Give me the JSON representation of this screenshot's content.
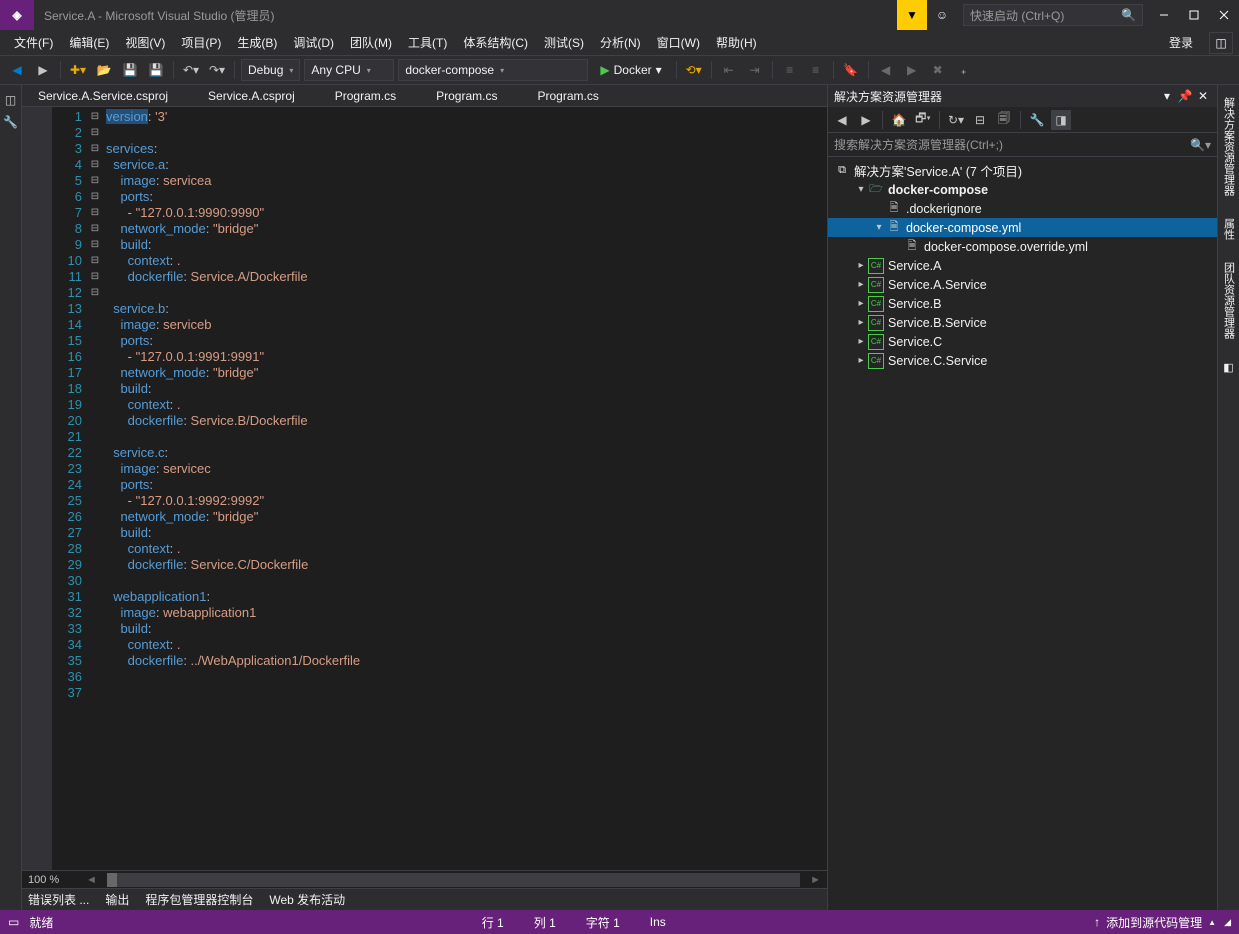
{
  "titlebar": {
    "title": "Service.A - Microsoft Visual Studio  (管理员)",
    "quick_launch_placeholder": "快速启动 (Ctrl+Q)"
  },
  "menubar": {
    "items": [
      "文件(F)",
      "编辑(E)",
      "视图(V)",
      "项目(P)",
      "生成(B)",
      "调试(D)",
      "团队(M)",
      "工具(T)",
      "体系结构(C)",
      "测试(S)",
      "分析(N)",
      "窗口(W)",
      "帮助(H)"
    ],
    "login": "登录"
  },
  "toolbar": {
    "config": "Debug",
    "platform": "Any CPU",
    "startup": "docker-compose",
    "run": "Docker"
  },
  "doctabs": [
    "Service.A.Service.csproj",
    "Service.A.csproj",
    "Program.cs",
    "Program.cs",
    "Program.cs"
  ],
  "editor": {
    "zoom": "100 %",
    "lines": [
      {
        "n": 1,
        "seg": [
          {
            "c": "k",
            "t": "version",
            "sel": true
          },
          {
            "c": "p",
            "t": ": "
          },
          {
            "c": "s",
            "t": "'3'"
          }
        ]
      },
      {
        "n": 2,
        "seg": []
      },
      {
        "n": 3,
        "fold": "-",
        "seg": [
          {
            "c": "k",
            "t": "services"
          },
          {
            "c": "p",
            "t": ":"
          }
        ]
      },
      {
        "n": 4,
        "fold": "-",
        "seg": [
          {
            "c": "p",
            "t": "  "
          },
          {
            "c": "k",
            "t": "service.a"
          },
          {
            "c": "p",
            "t": ":"
          }
        ]
      },
      {
        "n": 5,
        "seg": [
          {
            "c": "p",
            "t": "    "
          },
          {
            "c": "k",
            "t": "image"
          },
          {
            "c": "p",
            "t": ": "
          },
          {
            "c": "s",
            "t": "servicea"
          }
        ]
      },
      {
        "n": 6,
        "fold": "-",
        "seg": [
          {
            "c": "p",
            "t": "    "
          },
          {
            "c": "k",
            "t": "ports"
          },
          {
            "c": "p",
            "t": ":"
          }
        ]
      },
      {
        "n": 7,
        "seg": [
          {
            "c": "p",
            "t": "      - "
          },
          {
            "c": "s",
            "t": "\"127.0.0.1:9990:9990\""
          }
        ]
      },
      {
        "n": 8,
        "seg": [
          {
            "c": "p",
            "t": "    "
          },
          {
            "c": "k",
            "t": "network_mode"
          },
          {
            "c": "p",
            "t": ": "
          },
          {
            "c": "s",
            "t": "\"bridge\""
          }
        ]
      },
      {
        "n": 9,
        "fold": "-",
        "seg": [
          {
            "c": "p",
            "t": "    "
          },
          {
            "c": "k",
            "t": "build"
          },
          {
            "c": "p",
            "t": ":"
          }
        ]
      },
      {
        "n": 10,
        "seg": [
          {
            "c": "p",
            "t": "      "
          },
          {
            "c": "k",
            "t": "context"
          },
          {
            "c": "p",
            "t": ": "
          },
          {
            "c": "s",
            "t": "."
          }
        ]
      },
      {
        "n": 11,
        "seg": [
          {
            "c": "p",
            "t": "      "
          },
          {
            "c": "k",
            "t": "dockerfile"
          },
          {
            "c": "p",
            "t": ": "
          },
          {
            "c": "s",
            "t": "Service.A/Dockerfile"
          }
        ]
      },
      {
        "n": 12,
        "seg": []
      },
      {
        "n": 13,
        "fold": "-",
        "seg": [
          {
            "c": "p",
            "t": "  "
          },
          {
            "c": "k",
            "t": "service.b"
          },
          {
            "c": "p",
            "t": ":"
          }
        ]
      },
      {
        "n": 14,
        "seg": [
          {
            "c": "p",
            "t": "    "
          },
          {
            "c": "k",
            "t": "image"
          },
          {
            "c": "p",
            "t": ": "
          },
          {
            "c": "s",
            "t": "serviceb"
          }
        ]
      },
      {
        "n": 15,
        "fold": "-",
        "seg": [
          {
            "c": "p",
            "t": "    "
          },
          {
            "c": "k",
            "t": "ports"
          },
          {
            "c": "p",
            "t": ":"
          }
        ]
      },
      {
        "n": 16,
        "seg": [
          {
            "c": "p",
            "t": "      - "
          },
          {
            "c": "s",
            "t": "\"127.0.0.1:9991:9991\""
          }
        ]
      },
      {
        "n": 17,
        "seg": [
          {
            "c": "p",
            "t": "    "
          },
          {
            "c": "k",
            "t": "network_mode"
          },
          {
            "c": "p",
            "t": ": "
          },
          {
            "c": "s",
            "t": "\"bridge\""
          }
        ]
      },
      {
        "n": 18,
        "fold": "-",
        "seg": [
          {
            "c": "p",
            "t": "    "
          },
          {
            "c": "k",
            "t": "build"
          },
          {
            "c": "p",
            "t": ":"
          }
        ]
      },
      {
        "n": 19,
        "seg": [
          {
            "c": "p",
            "t": "      "
          },
          {
            "c": "k",
            "t": "context"
          },
          {
            "c": "p",
            "t": ": "
          },
          {
            "c": "s",
            "t": "."
          }
        ]
      },
      {
        "n": 20,
        "seg": [
          {
            "c": "p",
            "t": "      "
          },
          {
            "c": "k",
            "t": "dockerfile"
          },
          {
            "c": "p",
            "t": ": "
          },
          {
            "c": "s",
            "t": "Service.B/Dockerfile"
          }
        ]
      },
      {
        "n": 21,
        "seg": []
      },
      {
        "n": 22,
        "fold": "-",
        "seg": [
          {
            "c": "p",
            "t": "  "
          },
          {
            "c": "k",
            "t": "service.c"
          },
          {
            "c": "p",
            "t": ":"
          }
        ]
      },
      {
        "n": 23,
        "seg": [
          {
            "c": "p",
            "t": "    "
          },
          {
            "c": "k",
            "t": "image"
          },
          {
            "c": "p",
            "t": ": "
          },
          {
            "c": "s",
            "t": "servicec"
          }
        ]
      },
      {
        "n": 24,
        "fold": "-",
        "seg": [
          {
            "c": "p",
            "t": "    "
          },
          {
            "c": "k",
            "t": "ports"
          },
          {
            "c": "p",
            "t": ":"
          }
        ]
      },
      {
        "n": 25,
        "seg": [
          {
            "c": "p",
            "t": "      - "
          },
          {
            "c": "s",
            "t": "\"127.0.0.1:9992:9992\""
          }
        ]
      },
      {
        "n": 26,
        "seg": [
          {
            "c": "p",
            "t": "    "
          },
          {
            "c": "k",
            "t": "network_mode"
          },
          {
            "c": "p",
            "t": ": "
          },
          {
            "c": "s",
            "t": "\"bridge\""
          }
        ]
      },
      {
        "n": 27,
        "fold": "-",
        "seg": [
          {
            "c": "p",
            "t": "    "
          },
          {
            "c": "k",
            "t": "build"
          },
          {
            "c": "p",
            "t": ":"
          }
        ]
      },
      {
        "n": 28,
        "seg": [
          {
            "c": "p",
            "t": "      "
          },
          {
            "c": "k",
            "t": "context"
          },
          {
            "c": "p",
            "t": ": "
          },
          {
            "c": "s",
            "t": "."
          }
        ]
      },
      {
        "n": 29,
        "seg": [
          {
            "c": "p",
            "t": "      "
          },
          {
            "c": "k",
            "t": "dockerfile"
          },
          {
            "c": "p",
            "t": ": "
          },
          {
            "c": "s",
            "t": "Service.C/Dockerfile"
          }
        ]
      },
      {
        "n": 30,
        "seg": []
      },
      {
        "n": 31,
        "fold": "-",
        "seg": [
          {
            "c": "p",
            "t": "  "
          },
          {
            "c": "k",
            "t": "webapplication1"
          },
          {
            "c": "p",
            "t": ":"
          }
        ]
      },
      {
        "n": 32,
        "seg": [
          {
            "c": "p",
            "t": "    "
          },
          {
            "c": "k",
            "t": "image"
          },
          {
            "c": "p",
            "t": ": "
          },
          {
            "c": "s",
            "t": "webapplication1"
          }
        ]
      },
      {
        "n": 33,
        "fold": "-",
        "seg": [
          {
            "c": "p",
            "t": "    "
          },
          {
            "c": "k",
            "t": "build"
          },
          {
            "c": "p",
            "t": ":"
          }
        ]
      },
      {
        "n": 34,
        "seg": [
          {
            "c": "p",
            "t": "      "
          },
          {
            "c": "k",
            "t": "context"
          },
          {
            "c": "p",
            "t": ": "
          },
          {
            "c": "s",
            "t": "."
          }
        ]
      },
      {
        "n": 35,
        "seg": [
          {
            "c": "p",
            "t": "      "
          },
          {
            "c": "k",
            "t": "dockerfile"
          },
          {
            "c": "p",
            "t": ": "
          },
          {
            "c": "s",
            "t": "../WebApplication1/Dockerfile"
          }
        ]
      },
      {
        "n": 36,
        "seg": []
      },
      {
        "n": 37,
        "seg": []
      }
    ]
  },
  "bottom_tabs": [
    "错误列表 ...",
    "输出",
    "程序包管理器控制台",
    "Web 发布活动"
  ],
  "solution": {
    "title": "解决方案资源管理器",
    "search_placeholder": "搜索解决方案资源管理器(Ctrl+;)",
    "root": "解决方案'Service.A' (7 个项目)",
    "items": [
      {
        "d": 1,
        "tw": "▾",
        "ico": "proj",
        "label": "docker-compose",
        "bold": true
      },
      {
        "d": 2,
        "tw": "",
        "ico": "file",
        "label": ".dockerignore"
      },
      {
        "d": 2,
        "tw": "▾",
        "ico": "file",
        "label": "docker-compose.yml",
        "sel": true
      },
      {
        "d": 3,
        "tw": "",
        "ico": "file",
        "label": "docker-compose.override.yml"
      },
      {
        "d": 1,
        "tw": "▸",
        "ico": "cs",
        "label": "Service.A"
      },
      {
        "d": 1,
        "tw": "▸",
        "ico": "cs",
        "label": "Service.A.Service"
      },
      {
        "d": 1,
        "tw": "▸",
        "ico": "cs",
        "label": "Service.B"
      },
      {
        "d": 1,
        "tw": "▸",
        "ico": "cs",
        "label": "Service.B.Service"
      },
      {
        "d": 1,
        "tw": "▸",
        "ico": "cs",
        "label": "Service.C"
      },
      {
        "d": 1,
        "tw": "▸",
        "ico": "cs",
        "label": "Service.C.Service"
      }
    ]
  },
  "rightdock": [
    "解决方案资源管理器",
    "属性",
    "团队资源管理器",
    "◧"
  ],
  "statusbar": {
    "ready": "就绪",
    "line": "行 1",
    "col": "列 1",
    "char": "字符 1",
    "ins": "Ins",
    "scm": "添加到源代码管理"
  }
}
